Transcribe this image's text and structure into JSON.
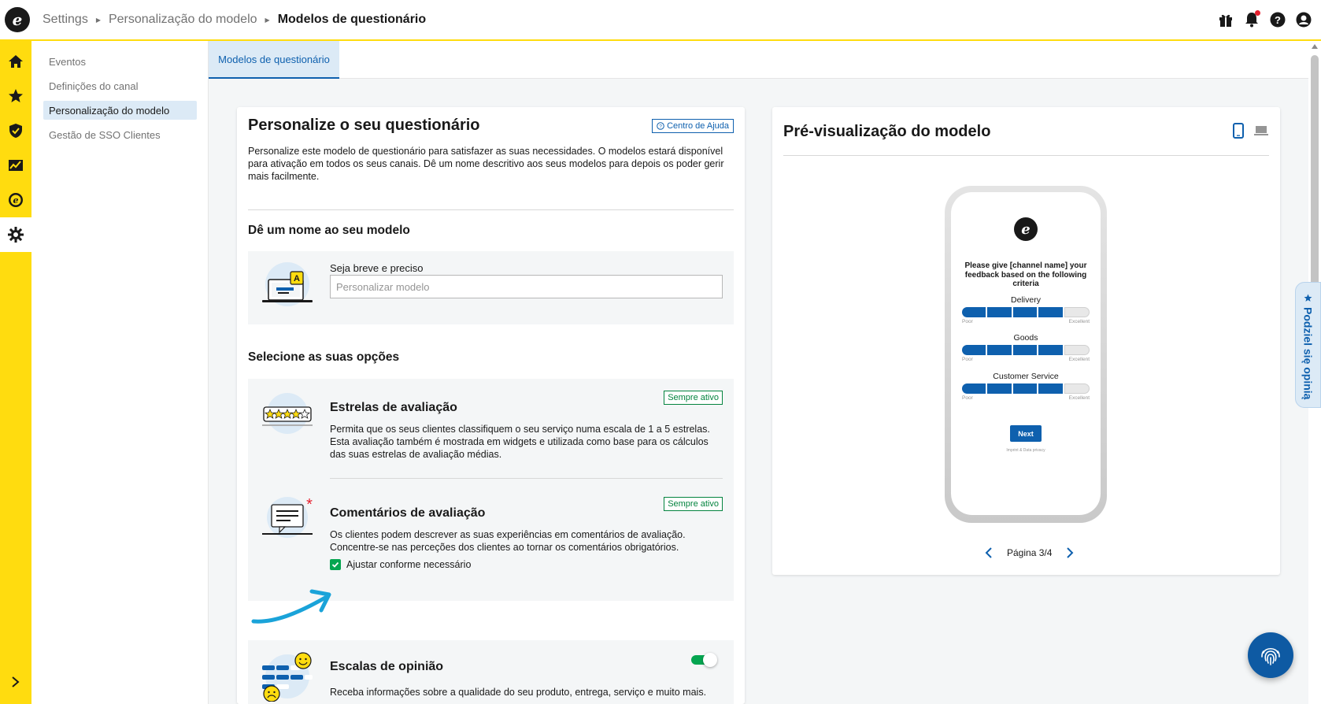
{
  "brand": {
    "logo_letter": "e",
    "accent": "#ffdc0f",
    "primary": "#0e60ae"
  },
  "breadcrumb": [
    "Settings",
    "Personalização do modelo",
    "Modelos de questionário"
  ],
  "top_icons": [
    "gift-icon",
    "bell-icon",
    "help-icon",
    "user-icon"
  ],
  "rail": [
    "home-icon",
    "star-icon",
    "shield-icon",
    "chart-icon",
    "trustedshops-icon",
    "gear-icon"
  ],
  "subnav": {
    "items": [
      "Eventos",
      "Definições do canal",
      "Personalização do modelo",
      "Gestão de SSO Clientes"
    ],
    "active": "Personalização do modelo"
  },
  "tabs": [
    "Modelos de questionário"
  ],
  "main": {
    "title": "Personalize o seu questionário",
    "help_link": "Centro de Ajuda",
    "description": "Personalize este modelo de questionário para satisfazer as suas necessidades. O modelos estará disponível para ativação em todos os seus canais. Dê um nome descritivo aos seus modelos para depois os poder gerir mais facilmente.",
    "name_section": {
      "title": "Dê um nome ao seu modelo",
      "field_label": "Seja breve e preciso",
      "field_placeholder": "Personalizar modelo",
      "field_value": ""
    },
    "options_title": "Selecione as suas opções",
    "options": [
      {
        "title": "Estrelas de avaliação",
        "description": "Permita que os seus clientes classifiquem o seu serviço numa escala de 1 a 5 estrelas. Esta avaliação também é mostrada em widgets e utilizada como base para os cálculos das suas estrelas de avaliação médias.",
        "badge": "Sempre ativo"
      },
      {
        "title": "Comentários de avaliação",
        "description": "Os clientes podem descrever as suas experiências em comentários de avaliação. Concentre-se nas perceções dos clientes ao tornar os comentários obrigatórios.",
        "badge": "Sempre ativo",
        "checkbox_label": "Ajustar conforme necessário",
        "checkbox_checked": true
      },
      {
        "title": "Escalas de opinião",
        "description": "Receba informações sobre a qualidade do seu produto, entrega, serviço e muito mais.",
        "toggle_on": true
      }
    ]
  },
  "preview": {
    "title": "Pré-visualização do modelo",
    "device_icons": [
      "phone-icon",
      "laptop-icon"
    ],
    "phone": {
      "prompt": "Please give [channel name] your feedback based on the following criteria",
      "criteria": [
        {
          "name": "Delivery",
          "rating": 4,
          "max": 5
        },
        {
          "name": "Goods",
          "rating": 4,
          "max": 5
        },
        {
          "name": "Customer Service",
          "rating": 4,
          "max": 5
        }
      ],
      "scale_low": "Poor",
      "scale_high": "Excellent",
      "next_label": "Next",
      "imprint": "Imprint & Data privacy"
    },
    "pager": "Página 3/4"
  },
  "feedback_tab": "Podziel się opinią"
}
